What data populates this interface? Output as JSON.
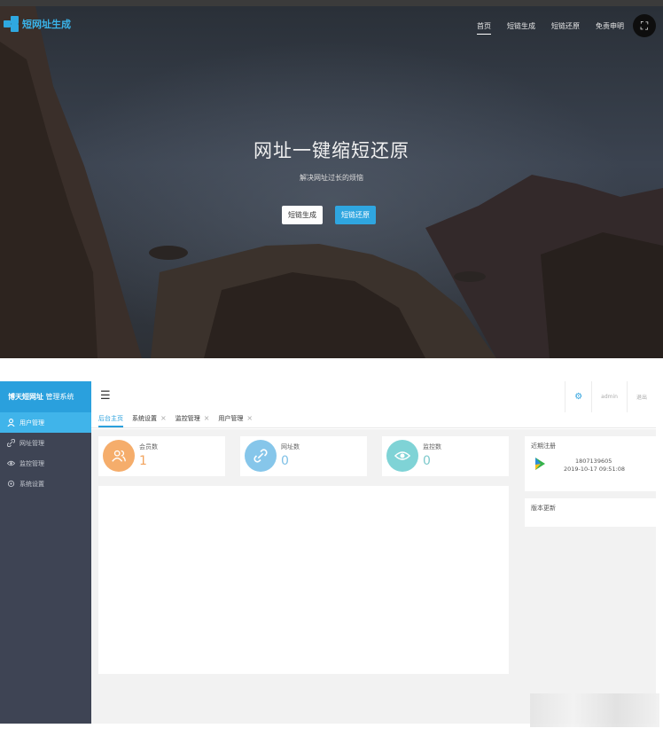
{
  "hero": {
    "logo_text": "短网址生成",
    "nav": [
      "首页",
      "短链生成",
      "短链还原",
      "免责申明"
    ],
    "title": "网址一键缩短还原",
    "subtitle": "解决网址过长的烦恼",
    "btn_generate": "短链生成",
    "btn_restore": "短链还原",
    "corner_icon": "scan-icon"
  },
  "admin": {
    "brand_bold": "博天短网址",
    "brand_rest": " 管理系统",
    "menu_icon": "hamburger-icon",
    "header": {
      "user": "admin",
      "logout": "退出",
      "settings_icon": "gear-icon"
    },
    "sidebar": [
      {
        "label": "用户管理",
        "icon": "user-icon"
      },
      {
        "label": "网址管理",
        "icon": "link-icon"
      },
      {
        "label": "监控管理",
        "icon": "eye-icon"
      },
      {
        "label": "系统设置",
        "icon": "settings-icon"
      }
    ],
    "tabs": [
      {
        "label": "后台主页"
      },
      {
        "label": "系统设置"
      },
      {
        "label": "监控管理"
      },
      {
        "label": "用户管理"
      }
    ],
    "stats": [
      {
        "label": "会员数",
        "value": "1",
        "color": "#f5ad6b",
        "num_color": "#f2a35c",
        "icon": "users-icon"
      },
      {
        "label": "网址数",
        "value": "0",
        "color": "#86c6ea",
        "num_color": "#7fc0e6",
        "icon": "link-icon"
      },
      {
        "label": "监控数",
        "value": "0",
        "color": "#7fd3d6",
        "num_color": "#7dc9cc",
        "icon": "eye-icon"
      }
    ],
    "recent": {
      "title": "近期注册",
      "user_id": "1807139605",
      "time": "2019-10-17 09:51:08"
    },
    "updates": {
      "title": "版本更新"
    }
  },
  "colors": {
    "accent": "#2aa0dd",
    "sidebar": "#3e4454",
    "active_item": "#40b4ea"
  }
}
